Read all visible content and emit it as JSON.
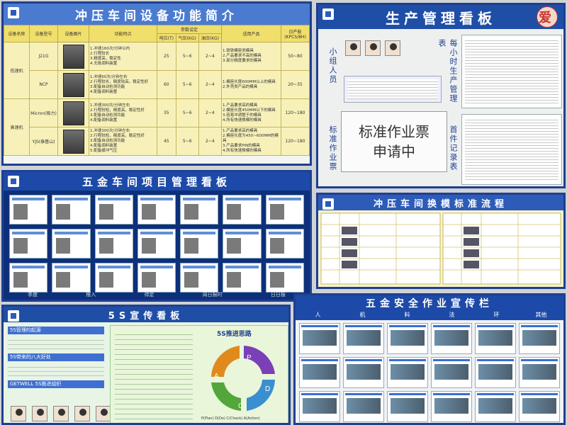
{
  "board1": {
    "title": "冲压车间设备功能简介",
    "headers": [
      "设备名称",
      "设备型号",
      "设备图片",
      "功能特点",
      "参数设定",
      "适用产品",
      "日产能(KPCS/8H)"
    ],
    "subheaders": [
      "吨位(T)",
      "气压(KG)",
      "油压(KG)"
    ],
    "rows": [
      {
        "group": "低速机",
        "model": "J21G",
        "features": "1.冲速160次/分钟以内\n2.行程较长\n3.精度高，稳定性\n4.无极调料装置",
        "ton": "25",
        "air": "5~6",
        "oil": "2~4",
        "products": "1.铁铁模座类模具\n2.产品要求不高的模具\n3.部分精度要求的模具",
        "capacity": "50~80"
      },
      {
        "group": "",
        "model": "NCP",
        "features": "1.冲速60次/分钟左右\n2.行程较长，精度较高，稳定性好\n3.配备自动检测功能\n4.配备调料装置",
        "ton": "60",
        "air": "5~6",
        "oil": "2~4",
        "products": "1.模座长度600MM以上的模具\n2.外壳类产品的模具",
        "capacity": "20~35"
      },
      {
        "group": "高速机",
        "model": "Micron(极力)",
        "features": "1.冲速300次/分钟左右\n2.行程较短，精度高，稳定性好\n3.配备自动检测功能\n4.配备调料装置",
        "ton": "35",
        "air": "5~6",
        "oil": "2~4",
        "products": "1.产品要求高的模具\n2.模座长度450MM以下的模具\n3.容易冲调整于的模具\n4.所有快速换模的模具",
        "capacity": "120~180"
      },
      {
        "group": "",
        "model": "YJS(泰基山)",
        "features": "1.冲速300次/分钟左右\n2.行程较短，精度高，稳定性好\n3.配备自动检测功能\n4.配备调料装置\n5.配备缓冲气压",
        "ton": "45",
        "air": "5~6",
        "oil": "2~4",
        "products": "1.产品要求高的模具\n2.模座长度为450~600MM的模具\n3.产品要求PIN的模具\n4.所有快速换模的模具",
        "capacity": "120~180"
      }
    ]
  },
  "board2": {
    "title": "生产管理看板",
    "heart": "爱",
    "left_label_top": "小组人员",
    "left_label_bottom": "标准作业票",
    "right_label_top": "每小时生产管理表",
    "right_label_bottom": "首件记录表",
    "stamp_line1": "标准作业票",
    "stamp_line2": "申请中"
  },
  "board3": {
    "title": "五金车间项目管理看板",
    "footer": [
      "季度",
      "推入",
      "待定",
      "周日报时",
      "日日报"
    ]
  },
  "board4": {
    "title": "冲压车间换模标准流程"
  },
  "board5": {
    "title": "5S宣传看板",
    "sections": [
      "5S管理的起源",
      "5S带来的八大好处",
      "GETWELL 5S推进组织"
    ],
    "panel_title": "5S推进思路",
    "pdca": [
      "P",
      "D",
      "C",
      "A"
    ],
    "pdca_legend": "P(Plan) D(Do) C(Check) A(Action)"
  },
  "board6": {
    "title": "五金安全作业宣传栏",
    "categories": [
      "人",
      "机",
      "料",
      "法",
      "环",
      "其他"
    ]
  }
}
